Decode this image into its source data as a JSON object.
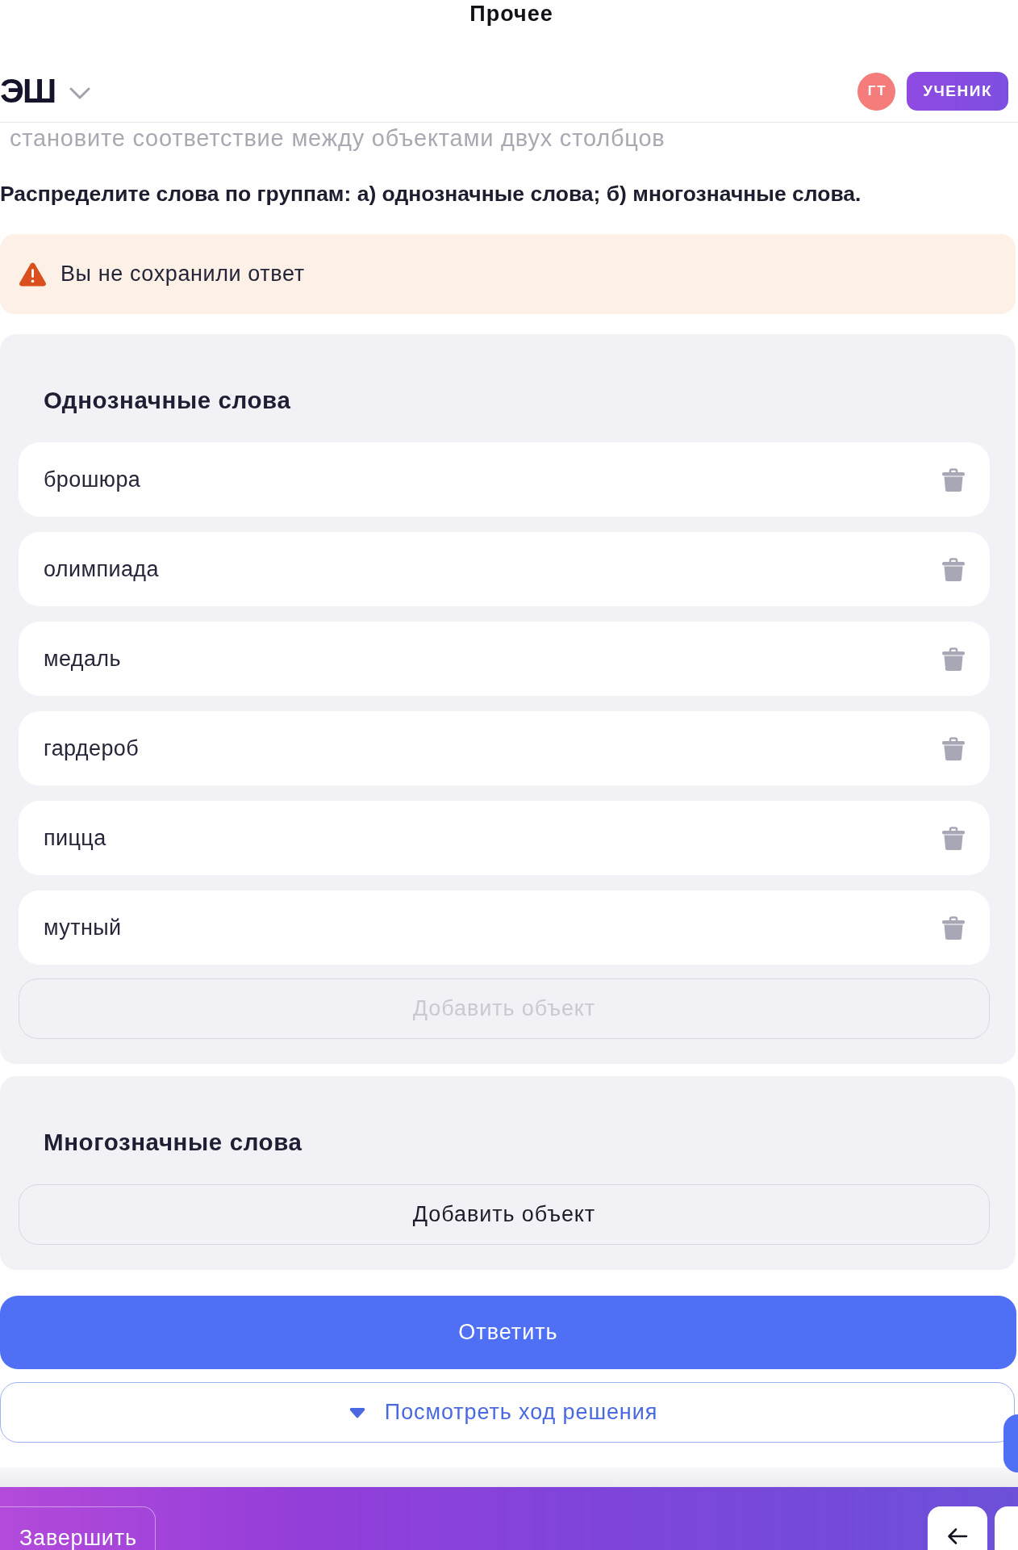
{
  "page_title": "Прочее",
  "header": {
    "logo": "ЭШ",
    "avatar": {
      "initials": "ГТ"
    },
    "role_badge": "УЧЕНИК"
  },
  "task": {
    "type_hint": "становите соответствие между объектами двух столбцов",
    "instruction": "Распределите слова по группам: а) однозначные слова; б) многозначные слова."
  },
  "alert": {
    "text": "Вы не сохранили ответ"
  },
  "groups": [
    {
      "title": "Однозначные слова",
      "items": [
        "брошюра",
        "олимпиада",
        "медаль",
        "гардероб",
        "пицца",
        "мутный"
      ],
      "add_button": {
        "label": "Добавить объект",
        "disabled": true
      }
    },
    {
      "title": "Многозначные слова",
      "add_button": {
        "label": "Добавить объект",
        "disabled": false
      }
    }
  ],
  "actions": {
    "submit": "Ответить",
    "solution_toggle": {
      "label": "Посмотреть ход решения",
      "expanded": false
    }
  },
  "bottom_bar": {
    "finish": "Завершить"
  }
}
